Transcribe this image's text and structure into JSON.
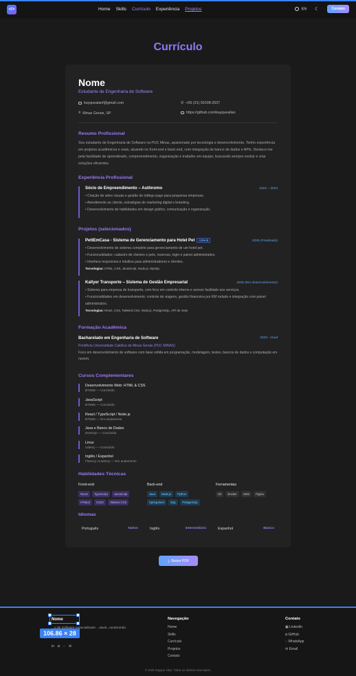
{
  "header": {
    "logo": "</>",
    "nav": [
      "Home",
      "Skills",
      "Currículo",
      "Experiência",
      "Projetos"
    ],
    "lang": "EN",
    "contact_button": "Contato"
  },
  "page_title": "Currículo",
  "resume": {
    "name": "Nome",
    "subtitle": "Estudante de Engenharia de Software",
    "email": "kayquealanf@gmail.com",
    "phone": "+55 (31) 99108-2537",
    "location": "Minas Gerais, SP",
    "github": "https://github.com/kayqueallan",
    "summary_title": "Resumo Profissional",
    "summary": "Sou estudante de Engenharia de Software na PUC Minas, apaixonado por tecnologia e desenvolvimento. Tenho experiência em projetos acadêmicos e reais, atuando no front-end e back-end, com integração de banco de dados e APIs. Destaco-me pela facilidade de aprendizado, comprometimento, organização e trabalho em equipe, buscando sempre evoluir e criar soluções eficientes.",
    "experience_title": "Experiência Profissional",
    "experience": {
      "title": "Sócio de Empreendimento – Autônomo",
      "date": "2022 – 2023",
      "bullets": [
        "Criação de artes visuais e gestão de tráfego pago para pequenas empresas.",
        "Atendimento ao cliente, estratégias de marketing digital e branding.",
        "Desenvolvimento de habilidades em design gráfico, comunicação e organização."
      ]
    },
    "projects_title": "Projetos (selecionados)",
    "projects": [
      {
        "title": "PettEmCasa - Sistema de Gerenciamento para Hotel Pet",
        "badge": "GitHub",
        "date": "2025 (Finalizado)",
        "bullets": [
          "Desenvolvimento de sistema completo para gerenciamento de um hotel pet.",
          "Funcionalidades: cadastro de clientes e pets, reservas, login e painel administrativo.",
          "Interface responsiva e intuitiva para administradores e clientes."
        ],
        "tech_label": "Tecnologias:",
        "tech": "HTML, CSS, JavaScript, Node.js, MySQL"
      },
      {
        "title": "Kallyer Transporte – Sistema de Gestão Empresarial",
        "date": "2025 (Em desenvolvimento)",
        "bullets": [
          "Sistema para empresa de transporte, com foco em controle interno e acesso facilitado aos serviços.",
          "Funcionalidades em desenvolvimento: controle de viagens, gestão financeira por KM rodado e integração com painel administrativo."
        ],
        "tech_label": "Tecnologias:",
        "tech": "React, CSS, Tailwind CSS, Node.js, PostgreSQL, API de rotas"
      }
    ],
    "education_title": "Formação Acadêmica",
    "education": {
      "title": "Bacharelado em Engenharia de Software",
      "date": "2023 - Atual",
      "school": "Pontifícia Universidade Católica de Minas Gerais (PUC MINAS)",
      "desc": "Foco em desenvolvimento de software com base sólida em programação, modelagem, testes, bancos de dados e computação em nuvem."
    },
    "courses_title": "Cursos Complementares",
    "courses": [
      {
        "title": "Desenvolvimento Web: HTML & CSS",
        "sub": "B7Web — Concluído"
      },
      {
        "title": "JavaScript",
        "sub": "B7Web — Concluído"
      },
      {
        "title": "React / TypeScript / Node.js",
        "sub": "B7Web — Em andamento"
      },
      {
        "title": "Java e Banco de Dados",
        "sub": "DevDojo — Concluído"
      },
      {
        "title": "Linux",
        "sub": "Udemy — Concluído"
      },
      {
        "title": "Inglês / Espanhol",
        "sub": "Fluency Academy — Em andamento"
      }
    ],
    "skills_title": "Habilidades Técnicas",
    "skills": {
      "frontend": {
        "title": "Front-end",
        "items": [
          "React",
          "TypeScript",
          "JavaScript",
          "HTML5",
          "CSS3",
          "Tailwind CSS"
        ]
      },
      "backend": {
        "title": "Back-end",
        "items": [
          "Java",
          "Node.js",
          "Python",
          "Spring Boot",
          "SQL",
          "PostgreSQL"
        ]
      },
      "tools": {
        "title": "Ferramentas",
        "items": [
          "Git",
          "Docker",
          "AWS",
          "Figma"
        ]
      }
    },
    "languages_title": "Idiomas",
    "languages": [
      {
        "name": "Português",
        "level": "Nativo"
      },
      {
        "name": "Inglês",
        "level": "Intermediário"
      },
      {
        "name": "Espanhol",
        "level": "Básico"
      }
    ],
    "pdf_button": "Baixar PDF"
  },
  "footer": {
    "name": "Nome",
    "desc": "...o de Software especializado ...stack, construindo",
    "dim_badge": "106.86 × 28",
    "nav_title": "Navegação",
    "nav": [
      "Home",
      "Skills",
      "Currículo",
      "Projetos",
      "Contato"
    ],
    "contact_title": "Contato",
    "contact": [
      "LinkedIn",
      "GitHub",
      "WhatsApp",
      "Email"
    ],
    "copyright": "© 2025 Kayque Allan. Todos os direitos reservados."
  },
  "colors": {
    "accent": "#8b7cf6",
    "blue": "#3b82f6",
    "bg": "#1a1a1a",
    "card": "#222222"
  }
}
